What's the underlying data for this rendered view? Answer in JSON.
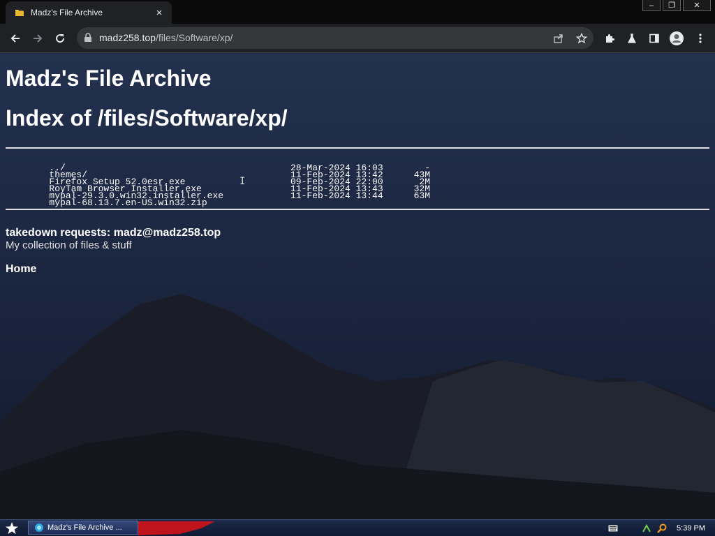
{
  "browser": {
    "tab": {
      "title": "Madz's File Archive",
      "close_glyph": "×",
      "favicon": "folder-icon"
    },
    "window_controls": [
      "–",
      "❐",
      "✕"
    ],
    "address": {
      "host": "madz258.top",
      "path": "/files/Software/xp/"
    }
  },
  "page": {
    "site_title": "Madz's File Archive",
    "index_title": "Index of /files/Software/xp/",
    "listing": [
      {
        "name": "../",
        "date": "",
        "size": ""
      },
      {
        "name": "themes/",
        "date": "28-Mar-2024 16:03",
        "size": "-"
      },
      {
        "name": "Firefox Setup 52.0esr.exe",
        "date": "11-Feb-2024 13:42",
        "size": "43M"
      },
      {
        "name": "RoyTam Browser Installer.exe",
        "date": "09-Feb-2024 22:00",
        "size": "2M"
      },
      {
        "name": "mypal-29.3.0.win32.installer.exe",
        "date": "11-Feb-2024 13:43",
        "size": "32M"
      },
      {
        "name": "mypal-68.13.7.en-US.win32.zip",
        "date": "11-Feb-2024 13:44",
        "size": "63M"
      }
    ],
    "takedown": "takedown requests: madz@madz258.top",
    "tagline": "My collection of files & stuff",
    "home_link": "Home",
    "cursor_glyph": "I"
  },
  "taskbar": {
    "task_label": "Madz's File Archive ...",
    "clock": "5:39 PM"
  },
  "colors": {
    "page_bg": "#141a2c",
    "chrome_dark": "#202124",
    "omnibox": "#35363a",
    "taskbar": "#1d2a48"
  }
}
